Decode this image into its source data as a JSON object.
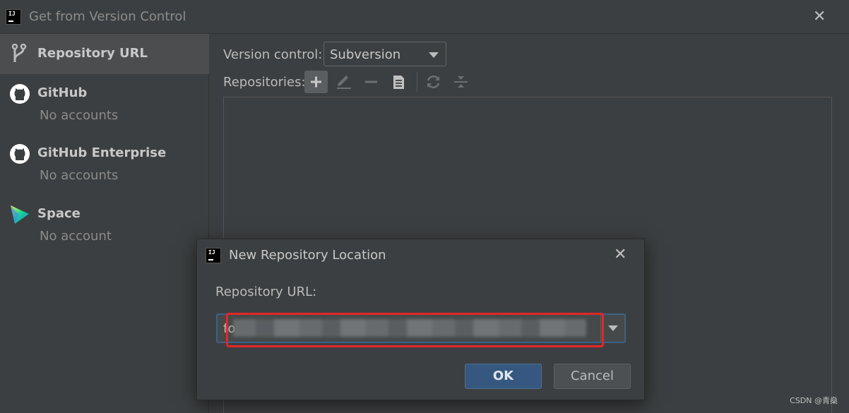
{
  "window": {
    "title": "Get from Version Control"
  },
  "sidebar": {
    "items": [
      {
        "label": "Repository URL",
        "sub": ""
      },
      {
        "label": "GitHub",
        "sub": "No accounts"
      },
      {
        "label": "GitHub Enterprise",
        "sub": "No accounts"
      },
      {
        "label": "Space",
        "sub": "No account"
      }
    ]
  },
  "main": {
    "version_control_label": "Version control:",
    "version_control_value": "Subversion",
    "repositories_label": "Repositories:",
    "toolbar_icons": [
      "add-icon",
      "edit-icon",
      "remove-icon",
      "copy-icon",
      "refresh-icon",
      "collapse-icon"
    ]
  },
  "dialog": {
    "title": "New Repository Location",
    "url_label": "Repository URL:",
    "url_value": "fo",
    "ok_label": "OK",
    "cancel_label": "Cancel"
  },
  "watermark": "CSDN @青燊",
  "colors": {
    "accent": "#365880",
    "highlight": "#e3262a",
    "background": "#3c3f41"
  }
}
